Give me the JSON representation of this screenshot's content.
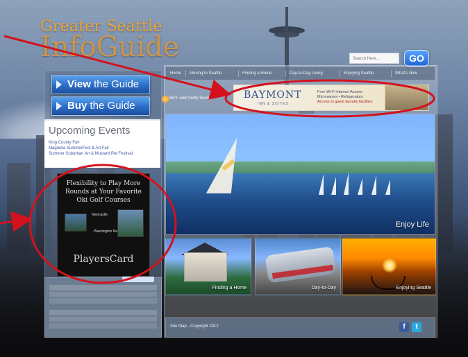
{
  "logo": {
    "line1": "Greater Seattle",
    "line2": "InfoGuide"
  },
  "search": {
    "placeholder": "Search Here...",
    "button": "GO"
  },
  "left": {
    "view_btn": {
      "bold": "View",
      "rest": " the Guide"
    },
    "buy_btn": {
      "bold": "Buy",
      "rest": " the Guide"
    },
    "upcoming_title": "Upcoming Events",
    "upcoming_items": [
      "King County Fair",
      "Magnolia SummerFest & Art Fair",
      "Summer Suburban Art & Mustard Pie Festival"
    ],
    "ad": {
      "headline": "Flexibility to Play More Rounds at Your Favorite Oki Golf Courses",
      "small1": "Newcastle",
      "small2": "Washington National",
      "brand": "PlayersCard"
    }
  },
  "nav": {
    "items": [
      "Home",
      "Moving to Seattle",
      "Finding a Home",
      "Day-to-Day Living",
      "Enjoying Seattle",
      "What's New"
    ]
  },
  "weather": {
    "text": "65°F and Partly Sunny"
  },
  "ad_top": {
    "brand": "BAYMONT",
    "tagline": "INN & SUITES",
    "copy_line1": "Free Wi-Fi Internet Access",
    "copy_line2": "Microwaves • Refrigerators",
    "copy_line3": "Access to guest laundry facilities"
  },
  "hero": {
    "caption": "Enjoy Life"
  },
  "thumbs": [
    {
      "caption": "Finding a Home"
    },
    {
      "caption": "Day-to-Day"
    },
    {
      "caption": "Enjoying Seattle"
    }
  ],
  "footer": {
    "text": "Site Map - Copyright 2012",
    "facebook": "f",
    "twitter": "t"
  },
  "colors": {
    "accent_orange": "#f0a33a",
    "annotation_red": "#d3121d",
    "button_blue": "#2c6cc7"
  }
}
